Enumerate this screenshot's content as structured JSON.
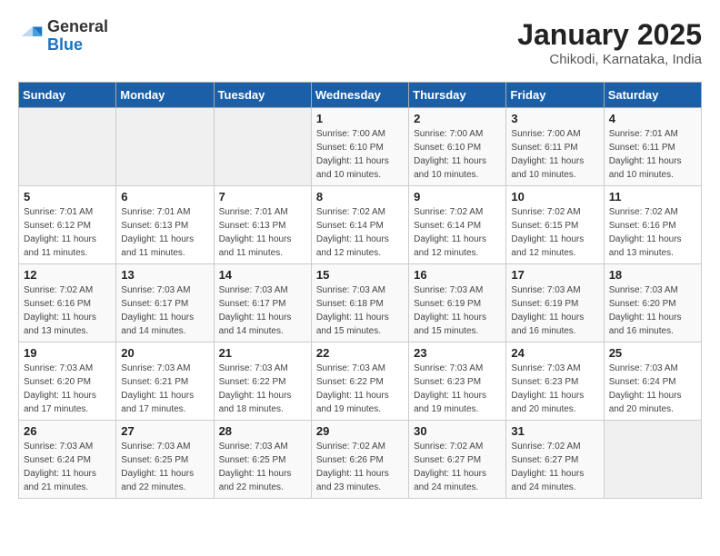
{
  "logo": {
    "general": "General",
    "blue": "Blue"
  },
  "header": {
    "month_year": "January 2025",
    "location": "Chikodi, Karnataka, India"
  },
  "days_of_week": [
    "Sunday",
    "Monday",
    "Tuesday",
    "Wednesday",
    "Thursday",
    "Friday",
    "Saturday"
  ],
  "weeks": [
    [
      {
        "day": "",
        "info": ""
      },
      {
        "day": "",
        "info": ""
      },
      {
        "day": "",
        "info": ""
      },
      {
        "day": "1",
        "info": "Sunrise: 7:00 AM\nSunset: 6:10 PM\nDaylight: 11 hours\nand 10 minutes."
      },
      {
        "day": "2",
        "info": "Sunrise: 7:00 AM\nSunset: 6:10 PM\nDaylight: 11 hours\nand 10 minutes."
      },
      {
        "day": "3",
        "info": "Sunrise: 7:00 AM\nSunset: 6:11 PM\nDaylight: 11 hours\nand 10 minutes."
      },
      {
        "day": "4",
        "info": "Sunrise: 7:01 AM\nSunset: 6:11 PM\nDaylight: 11 hours\nand 10 minutes."
      }
    ],
    [
      {
        "day": "5",
        "info": "Sunrise: 7:01 AM\nSunset: 6:12 PM\nDaylight: 11 hours\nand 11 minutes."
      },
      {
        "day": "6",
        "info": "Sunrise: 7:01 AM\nSunset: 6:13 PM\nDaylight: 11 hours\nand 11 minutes."
      },
      {
        "day": "7",
        "info": "Sunrise: 7:01 AM\nSunset: 6:13 PM\nDaylight: 11 hours\nand 11 minutes."
      },
      {
        "day": "8",
        "info": "Sunrise: 7:02 AM\nSunset: 6:14 PM\nDaylight: 11 hours\nand 12 minutes."
      },
      {
        "day": "9",
        "info": "Sunrise: 7:02 AM\nSunset: 6:14 PM\nDaylight: 11 hours\nand 12 minutes."
      },
      {
        "day": "10",
        "info": "Sunrise: 7:02 AM\nSunset: 6:15 PM\nDaylight: 11 hours\nand 12 minutes."
      },
      {
        "day": "11",
        "info": "Sunrise: 7:02 AM\nSunset: 6:16 PM\nDaylight: 11 hours\nand 13 minutes."
      }
    ],
    [
      {
        "day": "12",
        "info": "Sunrise: 7:02 AM\nSunset: 6:16 PM\nDaylight: 11 hours\nand 13 minutes."
      },
      {
        "day": "13",
        "info": "Sunrise: 7:03 AM\nSunset: 6:17 PM\nDaylight: 11 hours\nand 14 minutes."
      },
      {
        "day": "14",
        "info": "Sunrise: 7:03 AM\nSunset: 6:17 PM\nDaylight: 11 hours\nand 14 minutes."
      },
      {
        "day": "15",
        "info": "Sunrise: 7:03 AM\nSunset: 6:18 PM\nDaylight: 11 hours\nand 15 minutes."
      },
      {
        "day": "16",
        "info": "Sunrise: 7:03 AM\nSunset: 6:19 PM\nDaylight: 11 hours\nand 15 minutes."
      },
      {
        "day": "17",
        "info": "Sunrise: 7:03 AM\nSunset: 6:19 PM\nDaylight: 11 hours\nand 16 minutes."
      },
      {
        "day": "18",
        "info": "Sunrise: 7:03 AM\nSunset: 6:20 PM\nDaylight: 11 hours\nand 16 minutes."
      }
    ],
    [
      {
        "day": "19",
        "info": "Sunrise: 7:03 AM\nSunset: 6:20 PM\nDaylight: 11 hours\nand 17 minutes."
      },
      {
        "day": "20",
        "info": "Sunrise: 7:03 AM\nSunset: 6:21 PM\nDaylight: 11 hours\nand 17 minutes."
      },
      {
        "day": "21",
        "info": "Sunrise: 7:03 AM\nSunset: 6:22 PM\nDaylight: 11 hours\nand 18 minutes."
      },
      {
        "day": "22",
        "info": "Sunrise: 7:03 AM\nSunset: 6:22 PM\nDaylight: 11 hours\nand 19 minutes."
      },
      {
        "day": "23",
        "info": "Sunrise: 7:03 AM\nSunset: 6:23 PM\nDaylight: 11 hours\nand 19 minutes."
      },
      {
        "day": "24",
        "info": "Sunrise: 7:03 AM\nSunset: 6:23 PM\nDaylight: 11 hours\nand 20 minutes."
      },
      {
        "day": "25",
        "info": "Sunrise: 7:03 AM\nSunset: 6:24 PM\nDaylight: 11 hours\nand 20 minutes."
      }
    ],
    [
      {
        "day": "26",
        "info": "Sunrise: 7:03 AM\nSunset: 6:24 PM\nDaylight: 11 hours\nand 21 minutes."
      },
      {
        "day": "27",
        "info": "Sunrise: 7:03 AM\nSunset: 6:25 PM\nDaylight: 11 hours\nand 22 minutes."
      },
      {
        "day": "28",
        "info": "Sunrise: 7:03 AM\nSunset: 6:25 PM\nDaylight: 11 hours\nand 22 minutes."
      },
      {
        "day": "29",
        "info": "Sunrise: 7:02 AM\nSunset: 6:26 PM\nDaylight: 11 hours\nand 23 minutes."
      },
      {
        "day": "30",
        "info": "Sunrise: 7:02 AM\nSunset: 6:27 PM\nDaylight: 11 hours\nand 24 minutes."
      },
      {
        "day": "31",
        "info": "Sunrise: 7:02 AM\nSunset: 6:27 PM\nDaylight: 11 hours\nand 24 minutes."
      },
      {
        "day": "",
        "info": ""
      }
    ]
  ]
}
